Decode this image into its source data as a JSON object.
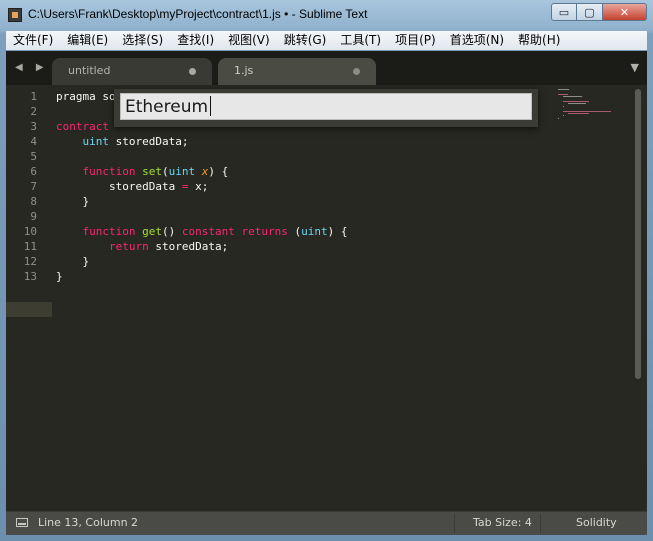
{
  "window": {
    "title": "C:\\Users\\Frank\\Desktop\\myProject\\contract\\1.js • - Sublime Text",
    "min_glyph": "▭",
    "max_glyph": "▢",
    "close_glyph": "✕"
  },
  "menu": [
    {
      "label": "文件(F)"
    },
    {
      "label": "编辑(E)"
    },
    {
      "label": "选择(S)"
    },
    {
      "label": "查找(I)"
    },
    {
      "label": "视图(V)"
    },
    {
      "label": "跳转(G)"
    },
    {
      "label": "工具(T)"
    },
    {
      "label": "项目(P)"
    },
    {
      "label": "首选项(N)"
    },
    {
      "label": "帮助(H)"
    }
  ],
  "tabs": {
    "nav_arrows": "◀ ▶",
    "dropdown_glyph": "▼",
    "items": [
      {
        "label": "untitled",
        "modified": true
      },
      {
        "label": "1.js",
        "modified": true,
        "active": true
      }
    ]
  },
  "editor": {
    "line_numbers": [
      "1",
      "2",
      "3",
      "4",
      "5",
      "6",
      "7",
      "8",
      "9",
      "10",
      "11",
      "12",
      "13"
    ],
    "current_line": 13,
    "lines": [
      "pragma so",
      "",
      "contract",
      "    uint storedData;",
      "",
      "    function set(uint x) {",
      "        storedData = x;",
      "    }",
      "",
      "    function get() constant returns (uint) {",
      "        return storedData;",
      "    }",
      "}"
    ]
  },
  "panel": {
    "input_value": "Ethereum"
  },
  "status": {
    "position": "Line 13, Column 2",
    "tab_size": "Tab Size: 4",
    "syntax": "Solidity"
  },
  "colors": {
    "background": "#272822",
    "keyword": "#f92672",
    "type": "#66d9ef",
    "function": "#a6e22e",
    "argument": "#fd971f"
  }
}
